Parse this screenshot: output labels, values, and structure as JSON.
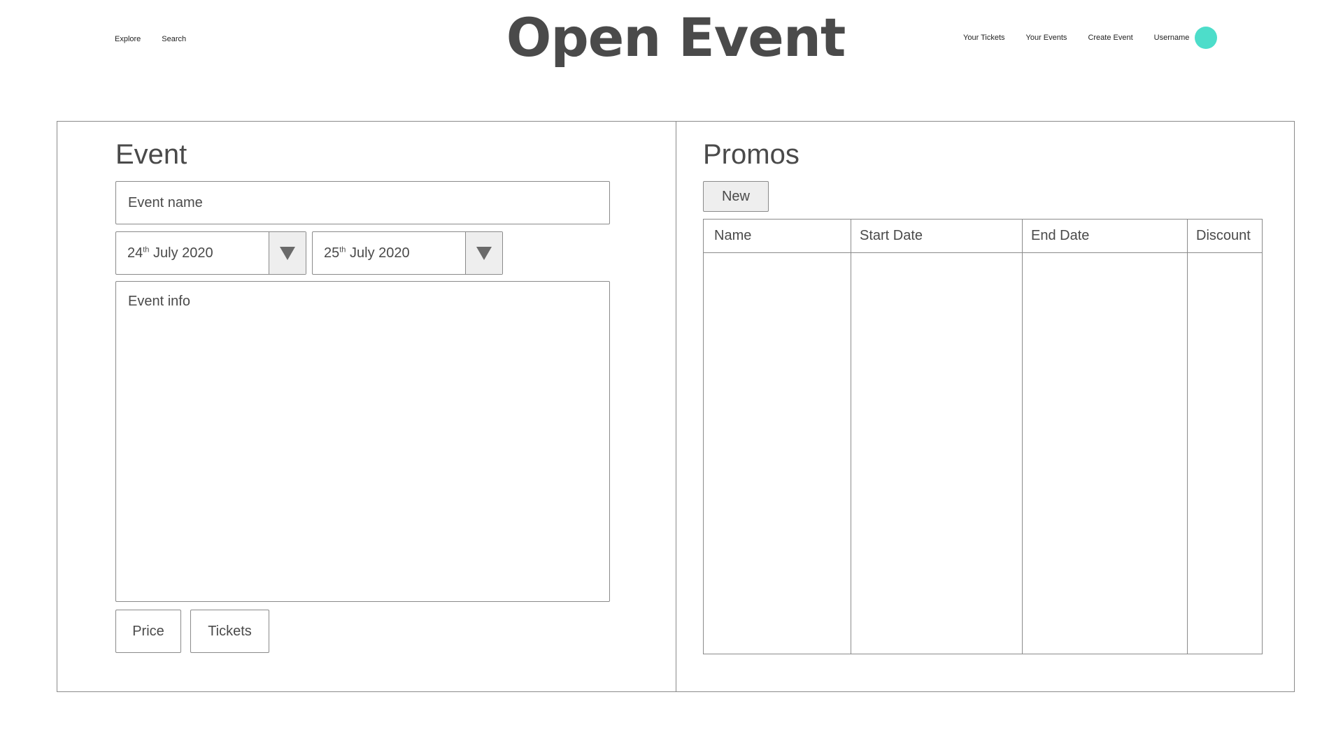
{
  "nav": {
    "explore": "Explore",
    "search": "Search",
    "your_tickets": "Your Tickets",
    "your_events": "Your Events",
    "create_event": "Create Event",
    "username": "Username",
    "avatar_color": "#4dddca"
  },
  "brand": "Open Event",
  "event": {
    "title": "Event",
    "name_placeholder": "Event name",
    "start_date": {
      "day": "24",
      "suffix": "th",
      "rest": "July 2020"
    },
    "end_date": {
      "day": "25",
      "suffix": "th",
      "rest": "July 2020"
    },
    "info_placeholder": "Event info",
    "price_label": "Price",
    "tickets_label": "Tickets"
  },
  "promos": {
    "title": "Promos",
    "new_label": "New",
    "columns": [
      "Name",
      "Start Date",
      "End Date",
      "Discount"
    ],
    "rows": []
  }
}
